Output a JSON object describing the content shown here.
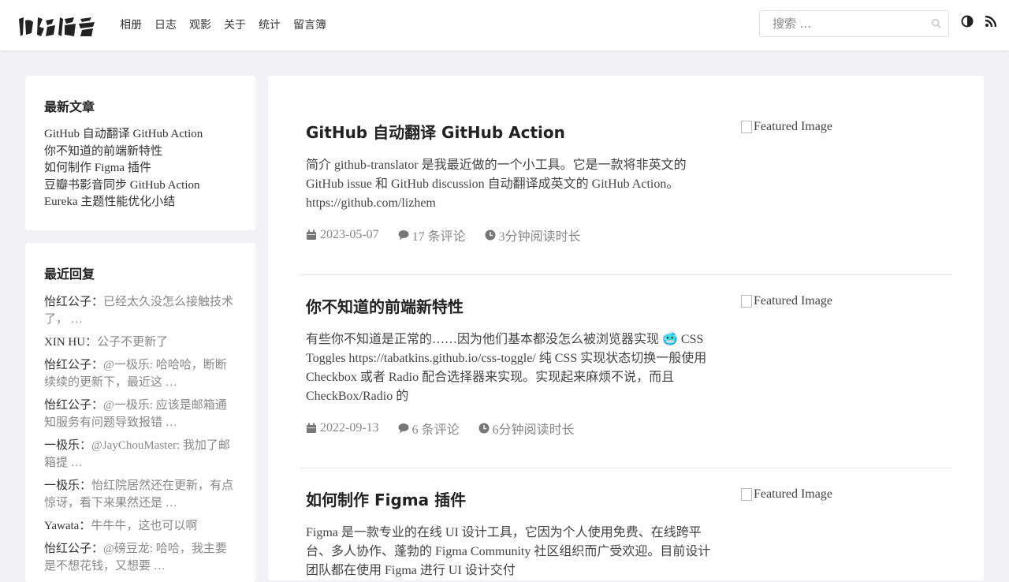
{
  "header": {
    "nav": [
      "相册",
      "日志",
      "观影",
      "关于",
      "统计",
      "留言簿"
    ],
    "search_placeholder": "搜索 ..."
  },
  "sidebar": {
    "latest_title": "最新文章",
    "latest_posts": [
      "GitHub 自动翻译 GitHub Action",
      "你不知道的前端新特性",
      "如何制作 Figma 插件",
      "豆瓣书影音同步 GitHub Action",
      "Eureka 主题性能优化小结"
    ],
    "replies_title": "最近回复",
    "replies": [
      {
        "author": "怡红公子：",
        "text": "已经太久没怎么接触技术了， …"
      },
      {
        "author": "XIN HU：",
        "text": "公子不更新了"
      },
      {
        "author": "怡红公子：",
        "text": "@一极乐: 哈哈哈，断断续续的更新下，最近这 …"
      },
      {
        "author": "怡红公子：",
        "text": "@一极乐: 应该是邮箱通知服务有问题导致报错 …"
      },
      {
        "author": "一极乐：",
        "text": "@JayChouMaster: 我加了邮箱提 …"
      },
      {
        "author": "一极乐：",
        "text": "怡红院居然还在更新，有点惊讶，看下来果然还是 …"
      },
      {
        "author": "Yawata：",
        "text": "牛牛牛，这也可以啊"
      },
      {
        "author": "怡红公子：",
        "text": "@磅豆龙: 哈哈，我主要是不想花钱，又想要 …"
      }
    ]
  },
  "posts": [
    {
      "title": "GitHub 自动翻译 GitHub Action",
      "excerpt": "简介 github-translator 是我最近做的一个小工具。它是一款将非英文的 GitHub issue 和 GitHub discussion 自动翻译成英文的 GitHub Action。 https://github.com/lizhem",
      "date": "2023-05-07",
      "comments": "17 条评论",
      "read_time": "3分钟阅读时长",
      "image_alt": "Featured Image"
    },
    {
      "title": "你不知道的前端新特性",
      "excerpt": "有些你不知道是正常的……因为他们基本都没怎么被浏览器实现 🥶 CSS Toggles https://tabatkins.github.io/css-toggle/ 纯 CSS 实现状态切换一般使用 Checkbox 或者 Radio 配合选择器来实现。实现起来麻烦不说，而且 CheckBox/Radio 的",
      "date": "2022-09-13",
      "comments": "6 条评论",
      "read_time": "6分钟阅读时长",
      "image_alt": "Featured Image"
    },
    {
      "title": "如何制作 Figma 插件",
      "excerpt": "Figma 是一款专业的在线 UI 设计工具，它因为个人使用免费、在线跨平台、多人协作、蓬勃的 Figma Community 社区组织而广受欢迎。目前设计团队都在使用 Figma 进行 UI 设计交付",
      "date": "",
      "comments": "",
      "read_time": "",
      "image_alt": "Featured Image"
    }
  ]
}
